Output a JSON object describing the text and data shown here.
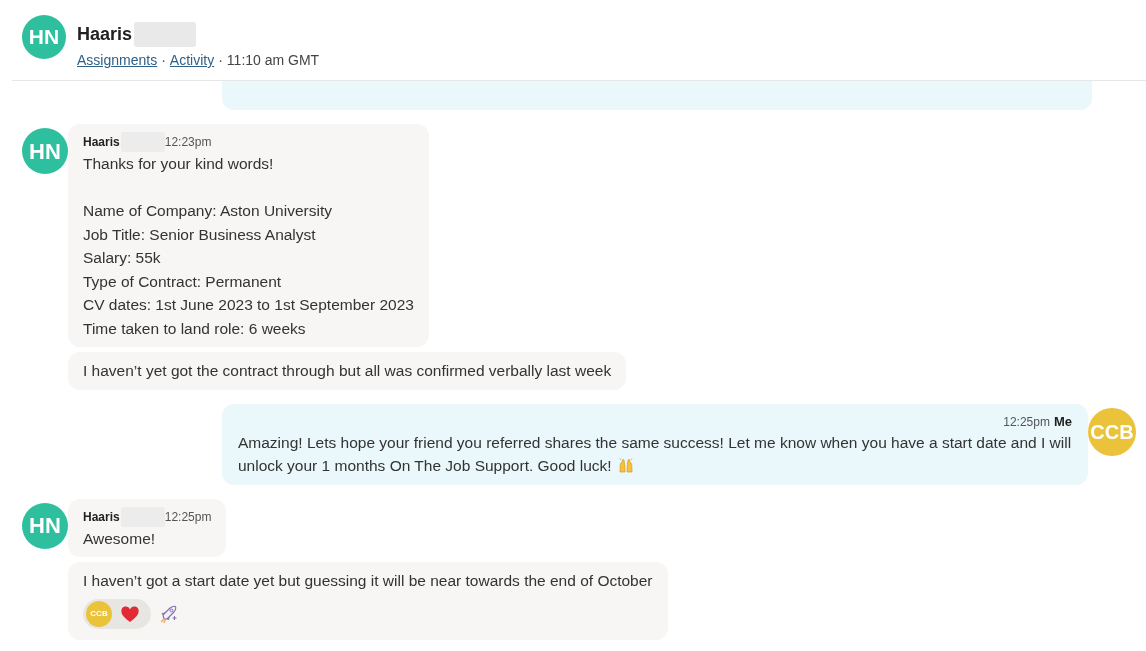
{
  "header": {
    "avatar": "HN",
    "color": "#2ebf9f",
    "name": "Haaris",
    "name_redacted": true,
    "links": [
      "Assignments",
      "Activity"
    ],
    "separator": "·",
    "time": "11:10 am GMT"
  },
  "messages": [
    {
      "kind": "outgoing",
      "cut_off": true
    },
    {
      "kind": "incoming",
      "avatar": "HN",
      "color": "#2ebf9f",
      "sender": "Haaris",
      "name_redacted": true,
      "time": "12:23pm",
      "bubbles": [
        {
          "paragraphs": [
            [
              "Thanks for your kind words!"
            ],
            [
              "Name of Company: Aston University",
              "Job Title: Senior Business Analyst",
              "Salary: 55k",
              "Type of Contract: Permanent",
              "CV dates: 1st June 2023 to 1st September 2023",
              "Time taken to land role: 6 weeks"
            ]
          ]
        },
        {
          "paragraphs": [
            [
              "I haven’t yet got the contract through but all was confirmed verbally last week"
            ]
          ]
        }
      ]
    },
    {
      "kind": "outgoing",
      "avatar": "CCB",
      "color": "#ebc33b",
      "sender": "Me",
      "time": "12:25pm",
      "bubbles": [
        {
          "paragraphs": [
            [
              "Amazing! Lets hope your friend you referred shares the same success! Let me know when you have a start date and I will",
              "unlock your 1 months On The Job Support. Good luck!"
            ]
          ],
          "emoji": true
        }
      ]
    },
    {
      "kind": "incoming",
      "avatar": "HN",
      "color": "#2ebf9f",
      "sender": "Haaris",
      "name_redacted": true,
      "time": "12:25pm",
      "bubbles": [
        {
          "paragraphs": [
            [
              "Awesome!"
            ]
          ]
        },
        {
          "paragraphs": [
            [
              "I haven’t got a start date yet but guessing it will be near towards the end of October"
            ]
          ],
          "reactions": [
            {
              "avatar": "CCB",
              "color": "#ebc33b"
            }
          ]
        }
      ]
    }
  ]
}
